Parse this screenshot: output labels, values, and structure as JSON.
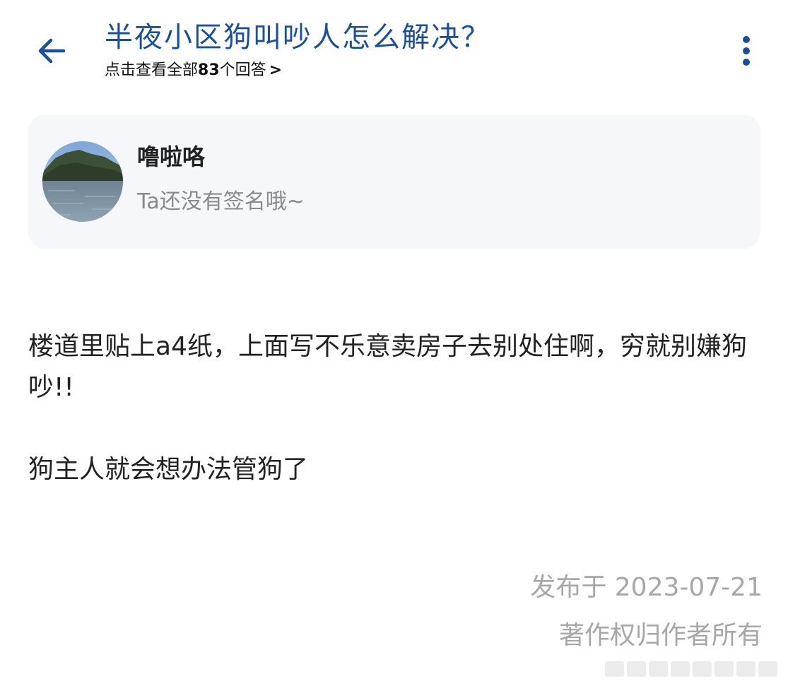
{
  "header": {
    "title": "半夜小区狗叫吵人怎么解决？",
    "subtitle_prefix": "点击查看全部",
    "answer_count": "83",
    "subtitle_suffix": "个回答",
    "subtitle_chevron": ">",
    "back_icon": "arrow-left-icon",
    "more_icon": "more-vertical-icon",
    "accent_color": "#1b4f9c"
  },
  "author": {
    "name": "噜啦咯",
    "signature": "Ta还没有签名哦~",
    "avatar_icon": "landscape-avatar"
  },
  "answer": {
    "paragraphs": [
      "楼道里贴上a4纸，上面写不乐意卖房子去别处住啊，穷就别嫌狗吵!!",
      "狗主人就会想办法管狗了"
    ]
  },
  "footer": {
    "publish_date": "发布于 2023-07-21",
    "copyright": "著作权归作者所有"
  }
}
